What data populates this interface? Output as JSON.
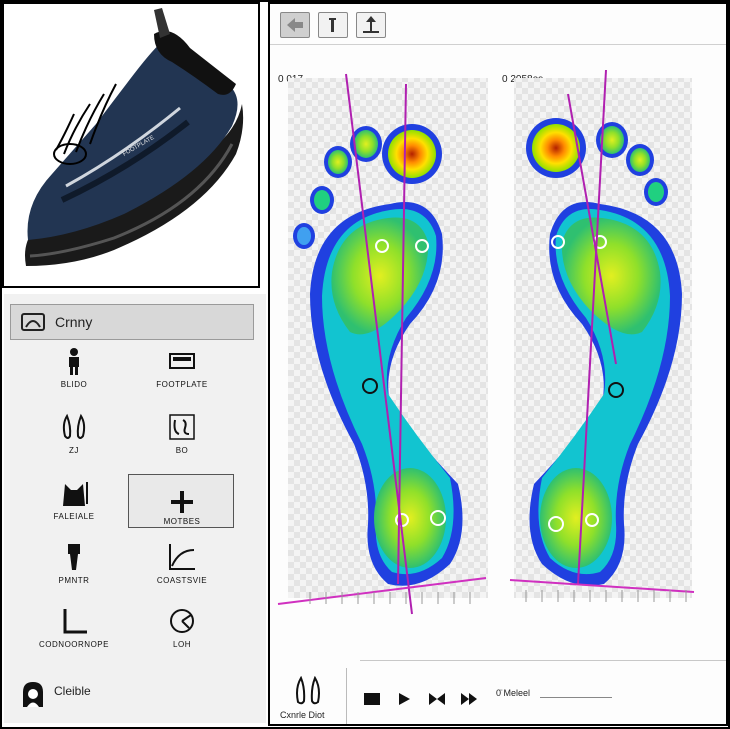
{
  "sidebar": {
    "mode_label": "Crnny",
    "tools": [
      {
        "label": "BLIDO",
        "icon": "figure-icon"
      },
      {
        "label": "FOOTPLATE",
        "icon": "platform-icon"
      },
      {
        "label": "ZJ",
        "icon": "footprints-icon"
      },
      {
        "label": "BO",
        "icon": "foot-outline-icon"
      },
      {
        "label": "FALEIALE",
        "icon": "body-balance-icon"
      },
      {
        "label": "MOTBES",
        "icon": "plus-icon"
      },
      {
        "label": "PMNTR",
        "icon": "leg-icon"
      },
      {
        "label": "COASTSVIE",
        "icon": "graph-curve-icon"
      },
      {
        "label": "CODNOORNOPE",
        "icon": "corner-icon"
      },
      {
        "label": "LOH",
        "icon": "angle-gauge-icon"
      }
    ],
    "bottom_label": "Cleible"
  },
  "viewer": {
    "toolbar": [
      "back-icon",
      "info-icon",
      "upload-icon"
    ],
    "left_foot_label": "0 017",
    "right_foot_label": "0 2058es",
    "player_label": "Cxnrle Diot",
    "time_label": "0̈ Meleel"
  }
}
